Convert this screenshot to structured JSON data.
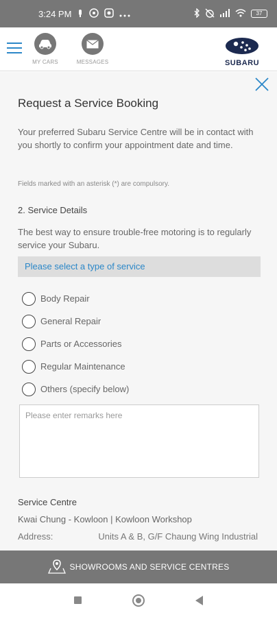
{
  "status_bar": {
    "time": "3:24 PM",
    "battery": "37"
  },
  "header": {
    "my_cars_label": "MY CARS",
    "messages_label": "MESSAGES",
    "logo_text": "SUBARU"
  },
  "form": {
    "title": "Request a Service Booking",
    "intro": "Your preferred Subaru Service Centre will be in contact with you shortly to confirm your appointment date and time.",
    "compulsory_note": "Fields marked with an asterisk (*) are compulsory.",
    "section_title": "2. Service Details",
    "section_desc": "The best way to ensure trouble-free motoring is to regularly service your Subaru.",
    "select_prompt": "Please select a type of service",
    "service_options": [
      "Body Repair",
      "General Repair",
      "Parts or Accessories",
      "Regular Maintenance",
      "Others (specify below)"
    ],
    "remarks_placeholder": "Please enter remarks here",
    "service_centre_label": "Service Centre",
    "service_centre_value": "Kwai Chung - Kowloon | Kowloon Workshop",
    "address_label": "Address:",
    "address_value": "Units A & B, G/F Chaung Wing Industrial"
  },
  "bottom_bar": {
    "label": "SHOWROOMS AND SERVICE CENTRES"
  },
  "colors": {
    "accent": "#2b87c8",
    "bar_gray": "#777777",
    "logo_navy": "#1c2a50"
  }
}
